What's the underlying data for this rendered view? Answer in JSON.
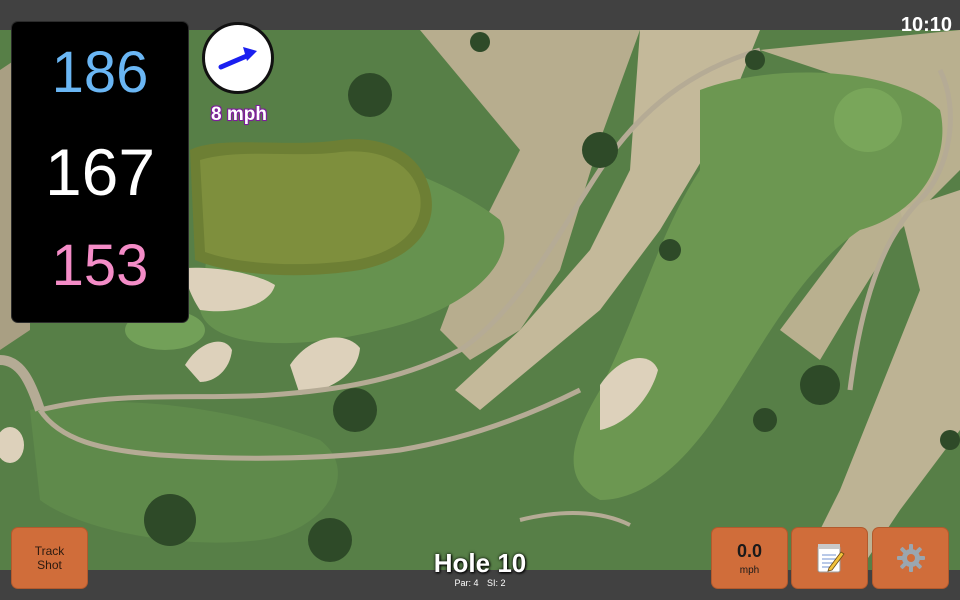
{
  "status": {
    "clock": "10:10"
  },
  "distances": {
    "back": "186",
    "center": "167",
    "front": "153"
  },
  "wind": {
    "speed_label": "8 mph",
    "direction_icon": "arrow-right-up-icon",
    "arrow_color": "#1a1ff0"
  },
  "buttons": {
    "track_shot": "Track Shot",
    "wind_value": "0.0",
    "wind_unit": "mph",
    "notes_icon": "notepad-icon",
    "settings_icon": "gear-icon"
  },
  "hole": {
    "title": "Hole 10",
    "par": "Par: 4",
    "si": "SI: 2"
  },
  "colors": {
    "back_distance": "#6ab6f4",
    "center_distance": "#ffffff",
    "front_distance": "#f48cc7",
    "button_bg": "#d06d3a",
    "wind_text_outline": "#7a1d98"
  }
}
